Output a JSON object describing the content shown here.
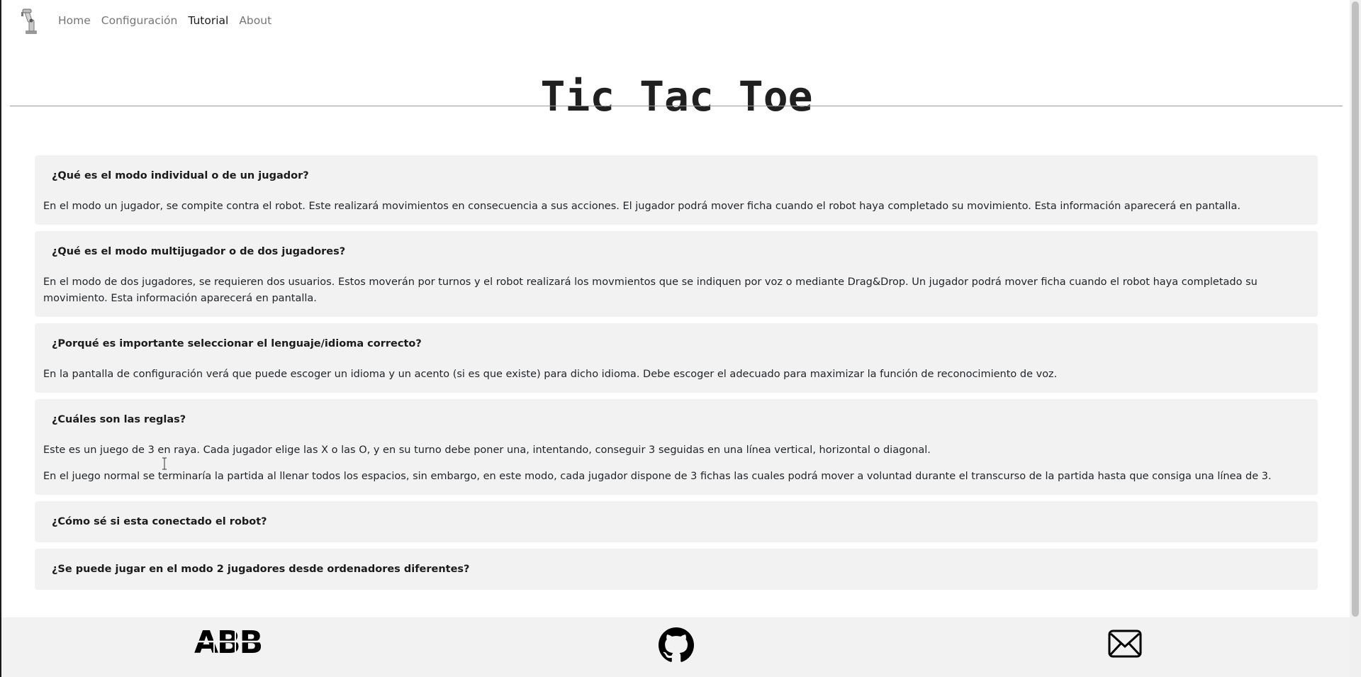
{
  "nav": {
    "items": [
      {
        "label": "Home",
        "active": false
      },
      {
        "label": "Configuración",
        "active": false
      },
      {
        "label": "Tutorial",
        "active": true
      },
      {
        "label": "About",
        "active": false
      }
    ],
    "brand_icon": "robot-arm-icon"
  },
  "page": {
    "title": "Tic Tac Toe"
  },
  "faq": {
    "items": [
      {
        "question": "¿Qué es el modo individual o de un jugador?",
        "answer": [
          "En el modo un jugador, se compite contra el robot. Este realizará movimientos en consecuencia a sus acciones. El jugador podrá mover ficha cuando el robot haya completado su movimiento. Esta información aparecerá en pantalla."
        ]
      },
      {
        "question": "¿Qué es el modo multijugador o de dos jugadores?",
        "answer": [
          "En el modo de dos jugadores, se requieren dos usuarios. Estos moverán por turnos y el robot realizará los movmientos que se indiquen por voz o mediante Drag&Drop. Un jugador podrá mover ficha cuando el robot haya completado su movimiento. Esta información aparecerá en pantalla."
        ]
      },
      {
        "question": "¿Porqué es importante seleccionar el lenguaje/idioma correcto?",
        "answer": [
          "En la pantalla de configuración verá que puede escoger un idioma y un acento (si es que existe) para dicho idioma. Debe escoger el adecuado para maximizar la función de reconocimiento de voz."
        ]
      },
      {
        "question": "¿Cuáles son las reglas?",
        "answer": [
          "Este es un juego de 3 en raya. Cada jugador elige las X o las O, y en su turno debe poner una, intentando, conseguir 3 seguidas en una línea vertical, horizontal o diagonal.",
          "En el juego normal se terminaría la partida al llenar todos los espacios, sin embargo, en este modo, cada jugador dispone de 3 fichas las cuales podrá mover a voluntad durante el transcurso de la partida hasta que consiga una línea de 3."
        ]
      },
      {
        "question": "¿Cómo sé si esta conectado el robot?",
        "answer": []
      },
      {
        "question": "¿Se puede jugar en el modo 2 jugadores desde ordenadores diferentes?",
        "answer": []
      }
    ]
  },
  "footer": {
    "icons": [
      "abb-logo-icon",
      "github-icon",
      "mail-icon"
    ],
    "abb_logo_text": "ABB"
  },
  "colors": {
    "faq_bg": "#f2f2f2",
    "footer_bg": "#f2f2f2",
    "title": "#202020",
    "nav_inactive": "#737373",
    "nav_active": "#1a1a1a"
  }
}
